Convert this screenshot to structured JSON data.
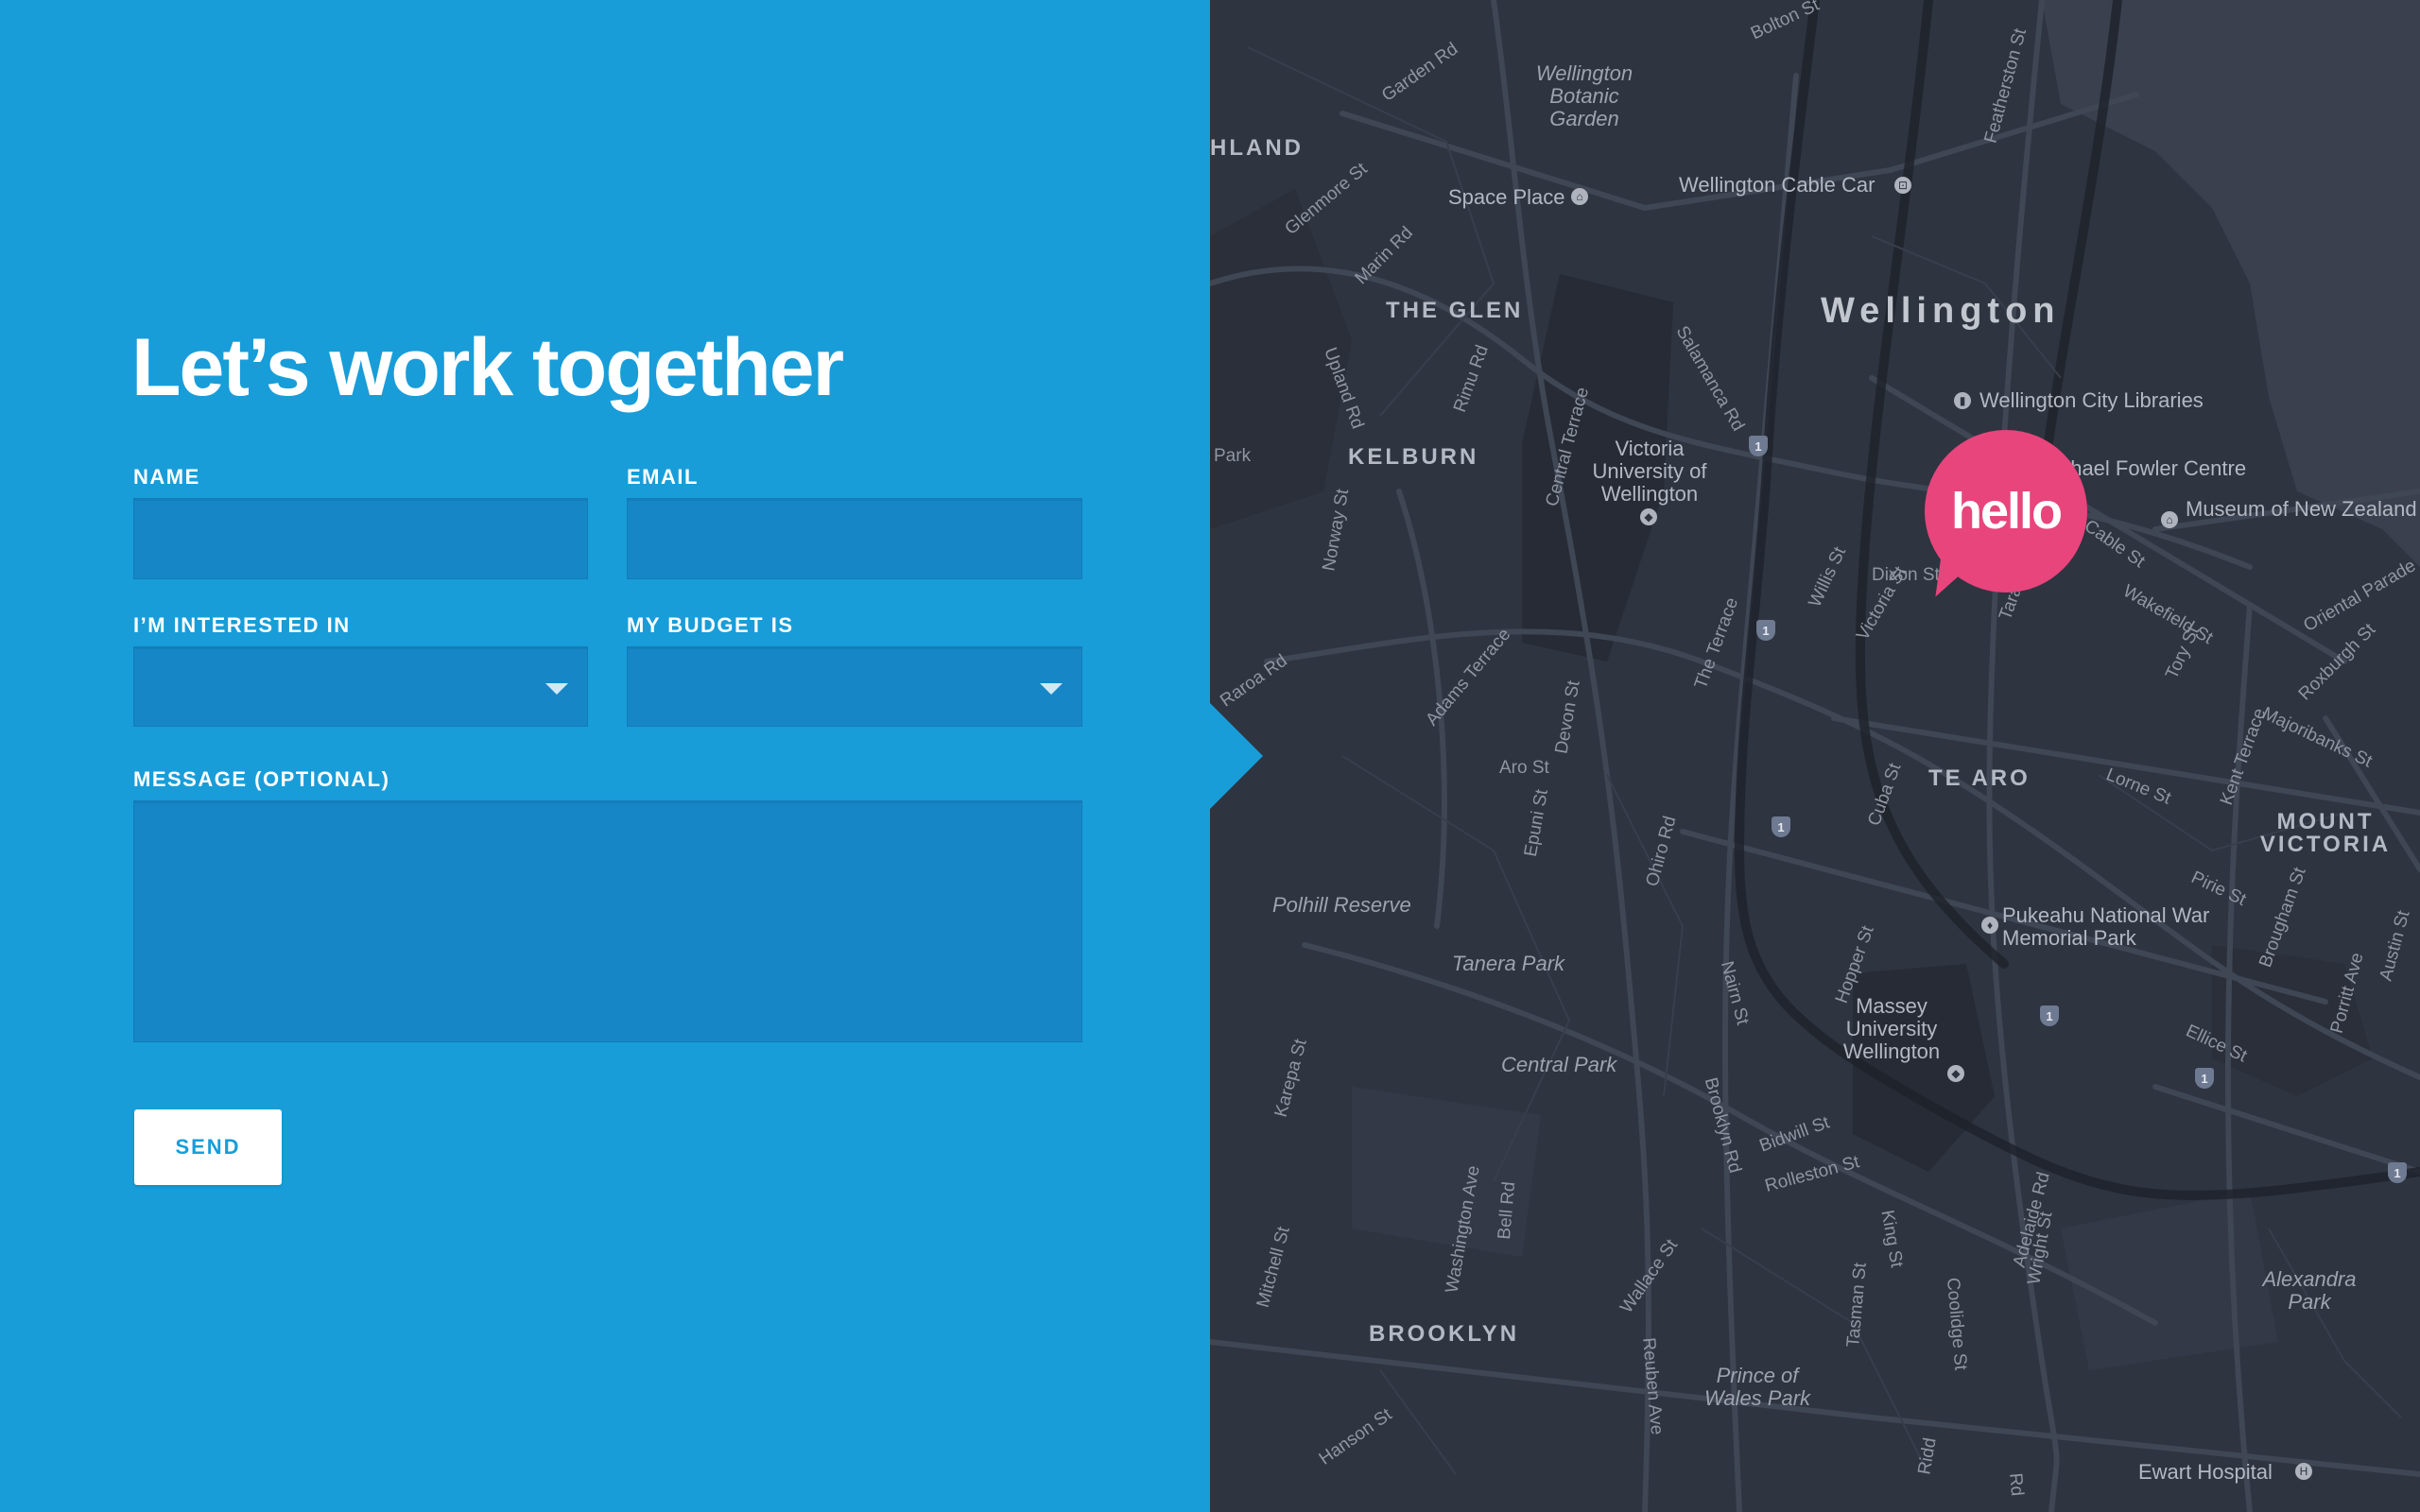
{
  "form": {
    "title": "Let’s work together",
    "name_label": "NAME",
    "email_label": "EMAIL",
    "interest_label": "I’M INTERESTED IN",
    "budget_label": "MY BUDGET IS",
    "message_label": "MESSAGE (OPTIONAL)",
    "name_value": "",
    "email_value": "",
    "interest_value": "",
    "budget_value": "",
    "message_value": "",
    "send_label": "SEND"
  },
  "map": {
    "bubble_text": "hello",
    "city": "Wellington",
    "districts": [
      "THE GLEN",
      "KELBURN",
      "TE ARO",
      "MOUNT VICTORIA",
      "BROOKLYN",
      "HLAND"
    ],
    "pois": [
      "Wellington Botanic Garden",
      "Polhill Reserve",
      "Tanera Park",
      "Central Park",
      "Prince of Wales Park",
      "Alexandra Park"
    ],
    "places": [
      "Wellington Cable Car",
      "Space Place",
      "Wellington City Libraries",
      "Michael Fowler Centre",
      "Museum of New Zealand Te Papa Tongarewa",
      "Victoria University of Wellington",
      "Pukeahu National War Memorial Park",
      "Massey University Wellington",
      "Ewart Hospital"
    ],
    "streets": [
      "Garden Rd",
      "Glenmore St",
      "Bolton St",
      "Featherston St",
      "Marin Rd",
      "Upland Rd",
      "Rimu Rd",
      "Salamanca Rd",
      "Central Terrace",
      "Norway St",
      "Willis St",
      "Victoria St",
      "Dixon St",
      "Taranaki St",
      "Cable St",
      "Wakefield St",
      "Tory St",
      "Oriental Parade",
      "Roxburgh St",
      "Majoribanks St",
      "Kent Terrace",
      "Lorne St",
      "Adams Terrace",
      "Devon St",
      "The Terrace",
      "Aro St",
      "Epuni St",
      "Ohiro Rd",
      "Cuba St",
      "Raroa Rd",
      "Pirie St",
      "Brougham St",
      "Austin St",
      "Porritt Ave",
      "Hopper St",
      "Nairn St",
      "Ellice St",
      "Karepa St",
      "Brooklyn Rd",
      "Bidwill St",
      "Rolleston St",
      "Mitchell St",
      "Washington Ave",
      "Bell Rd",
      "Wallace St",
      "King St",
      "Adelaide Rd",
      "Wright St",
      "Tasman St",
      "Coolidge St",
      "Reuben Ave",
      "Hanson St",
      "Ridd",
      "Rd",
      "Park"
    ]
  },
  "colors": {
    "form_bg": "#189dd9",
    "field_bg": "#1686c6",
    "map_bg": "#2e3440",
    "bubble": "#e8457c"
  }
}
